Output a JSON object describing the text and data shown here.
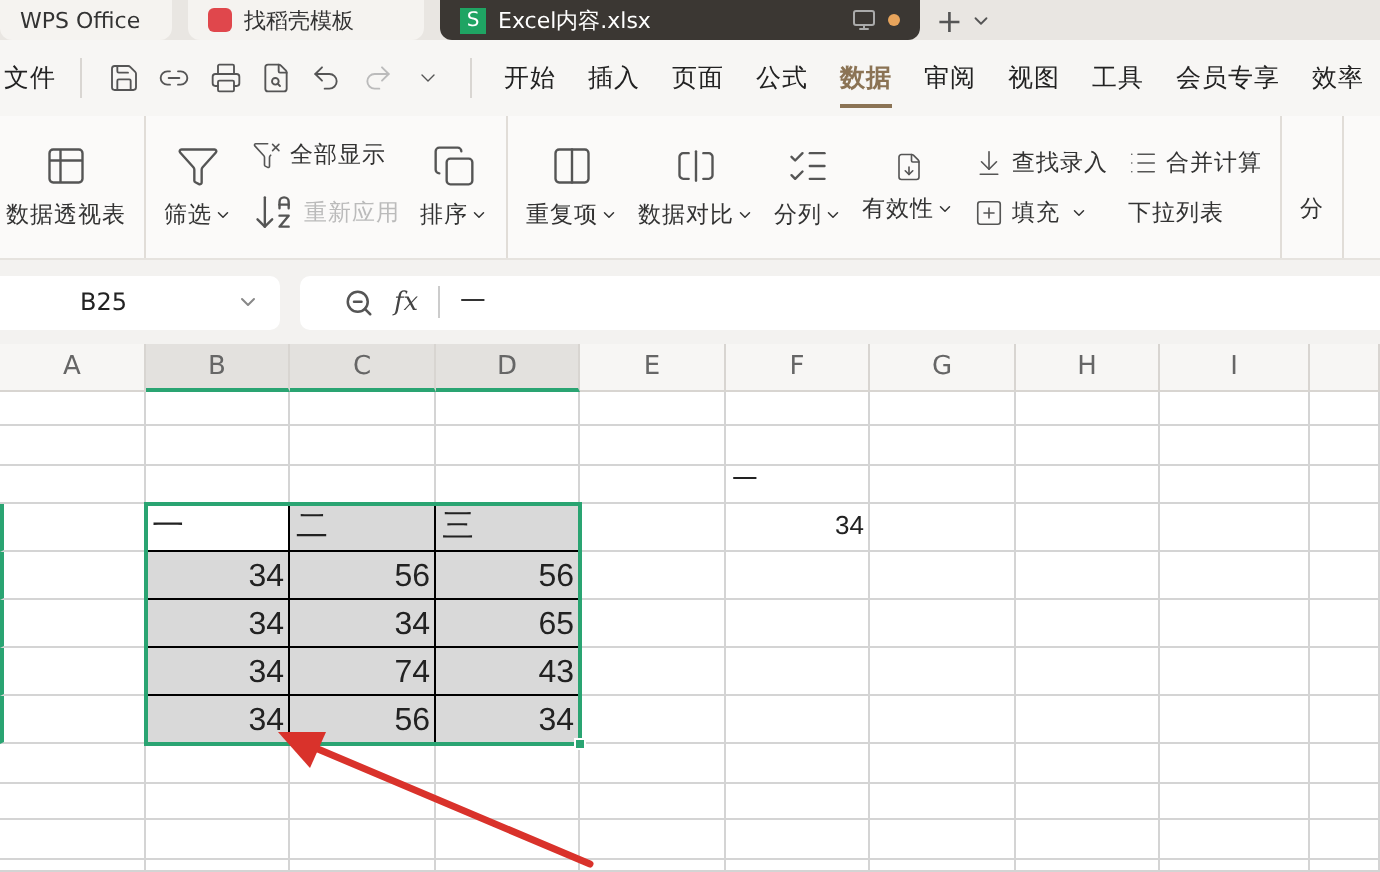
{
  "tabs": [
    {
      "label": "WPS Office",
      "selected": false
    },
    {
      "label": "找稻壳模板",
      "selected": false
    },
    {
      "label": "Excel内容.xlsx",
      "selected": true,
      "modified": true,
      "badge": "S"
    }
  ],
  "new_tab": "+",
  "file_menu": "文件",
  "menu": [
    {
      "label": "开始",
      "selected": false
    },
    {
      "label": "插入",
      "selected": false
    },
    {
      "label": "页面",
      "selected": false
    },
    {
      "label": "公式",
      "selected": false
    },
    {
      "label": "数据",
      "selected": true
    },
    {
      "label": "审阅",
      "selected": false
    },
    {
      "label": "视图",
      "selected": false
    },
    {
      "label": "工具",
      "selected": false
    },
    {
      "label": "会员专享",
      "selected": false
    },
    {
      "label": "效率",
      "selected": false
    }
  ],
  "ribbon": [
    [
      {
        "kind": "big",
        "label": "数据透视表",
        "dropdown": false,
        "disabled": false
      }
    ],
    [
      {
        "kind": "big",
        "label": "筛选",
        "dropdown": true,
        "disabled": false
      },
      {
        "kind": "stack",
        "items": [
          {
            "label": "全部显示",
            "dropdown": false,
            "disabled": false
          },
          {
            "label": "重新应用",
            "dropdown": false,
            "disabled": true
          }
        ]
      },
      {
        "kind": "big",
        "label": "排序",
        "dropdown": true,
        "disabled": false
      }
    ],
    [
      {
        "kind": "big",
        "label": "重复项",
        "dropdown": true,
        "disabled": false
      },
      {
        "kind": "big",
        "label": "数据对比",
        "dropdown": true,
        "disabled": false
      },
      {
        "kind": "big",
        "label": "分列",
        "dropdown": true,
        "disabled": false
      },
      {
        "kind": "big",
        "label": "有效性",
        "dropdown": true,
        "disabled": false
      },
      {
        "kind": "stack",
        "items": [
          {
            "label": "查找录入",
            "dropdown": false,
            "disabled": false
          },
          {
            "label": "填充",
            "dropdown": true,
            "disabled": false
          }
        ]
      },
      {
        "kind": "stack",
        "items": [
          {
            "label": "合并计算",
            "dropdown": false,
            "disabled": false
          },
          {
            "label": "下拉列表",
            "dropdown": false,
            "disabled": false
          }
        ]
      }
    ],
    [
      {
        "kind": "cut",
        "label": "分"
      }
    ]
  ],
  "name_box": "B25",
  "fx": "fx",
  "formula": "一",
  "columns": [
    {
      "label": "A",
      "selected": false
    },
    {
      "label": "B",
      "selected": true
    },
    {
      "label": "C",
      "selected": true
    },
    {
      "label": "D",
      "selected": true
    },
    {
      "label": "E",
      "selected": false
    },
    {
      "label": "F",
      "selected": false
    },
    {
      "label": "G",
      "selected": false
    },
    {
      "label": "H",
      "selected": false
    },
    {
      "label": "I",
      "selected": false
    }
  ],
  "table": {
    "header": [
      "一",
      "二",
      "三"
    ],
    "rows": [
      [
        "34",
        "56",
        "56"
      ],
      [
        "34",
        "34",
        "65"
      ],
      [
        "34",
        "74",
        "43"
      ],
      [
        "34",
        "56",
        "34"
      ]
    ]
  },
  "side_cells": [
    {
      "text": "一",
      "kind": "text"
    },
    {
      "text": "34",
      "kind": "number"
    }
  ]
}
